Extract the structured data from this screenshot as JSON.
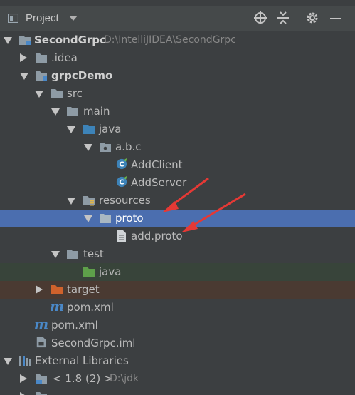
{
  "header": {
    "title": "Project",
    "dropdown_icon": "chevron-down-icon",
    "actions": [
      "target-icon",
      "collapse-icon",
      "gear-icon",
      "minimize-icon"
    ]
  },
  "tree": {
    "root_label": "SecondGrpc",
    "root_path": "D:\\IntelliJIDEA\\SecondGrpc",
    "idea": ".idea",
    "module": "grpcDemo",
    "src": "src",
    "main": "main",
    "java_main": "java",
    "package": "a.b.c",
    "add_client": "AddClient",
    "add_server": "AddServer",
    "resources": "resources",
    "proto": "proto",
    "add_proto": "add.proto",
    "test": "test",
    "java_test": "java",
    "target": "target",
    "module_pom": "pom.xml",
    "root_pom": "pom.xml",
    "iml": "SecondGrpc.iml",
    "external": "External Libraries",
    "jdk_label": "< 1.8 (2) >",
    "jdk_path": "D:\\jdk"
  },
  "colors": {
    "background": "#3c3f41",
    "selection": "#4b6eaf",
    "annotation_arrow": "#e53935"
  }
}
